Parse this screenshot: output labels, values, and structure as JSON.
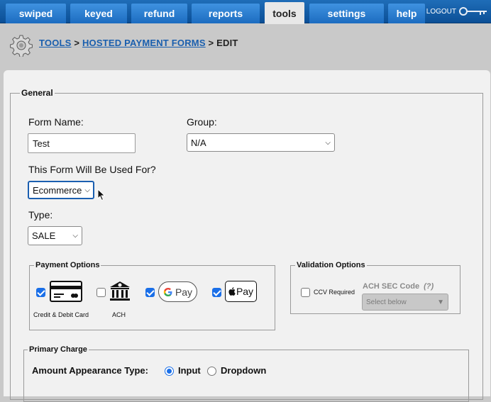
{
  "nav": {
    "tabs": [
      "swiped",
      "keyed",
      "refund",
      "reports",
      "tools",
      "settings",
      "help"
    ],
    "active": "tools",
    "logout": "LOGOUT"
  },
  "breadcrumb": {
    "tools": "TOOLS",
    "sep1": ">",
    "hosted": "HOSTED PAYMENT FORMS",
    "sep2": ">",
    "current": "EDIT"
  },
  "general": {
    "legend": "General",
    "form_name_label": "Form Name:",
    "form_name_value": "Test",
    "group_label": "Group:",
    "group_value": "N/A",
    "used_for_label": "This Form Will Be Used For?",
    "used_for_value": "Ecommerce",
    "type_label": "Type:",
    "type_value": "SALE"
  },
  "payment_options": {
    "legend": "Payment Options",
    "card_label": "Credit & Debit Card",
    "ach_label": "ACH",
    "gpay_label": "Pay",
    "applepay_label": "Pay",
    "checked": {
      "card": true,
      "ach": false,
      "gpay": true,
      "applepay": true
    }
  },
  "validation_options": {
    "legend": "Validation Options",
    "ccv_label": "CCV Required",
    "ach_sec_label": "ACH SEC Code",
    "ach_sec_help": "(?)",
    "ach_sec_placeholder": "Select below"
  },
  "primary_charge": {
    "legend": "Primary Charge",
    "amount_label": "Amount Appearance Type:",
    "input_label": "Input",
    "dropdown_label": "Dropdown",
    "selected": "Input"
  },
  "colors": {
    "nav_blue": "#1c6cc0",
    "link": "#1a5fae",
    "check": "#1a6fe8"
  }
}
